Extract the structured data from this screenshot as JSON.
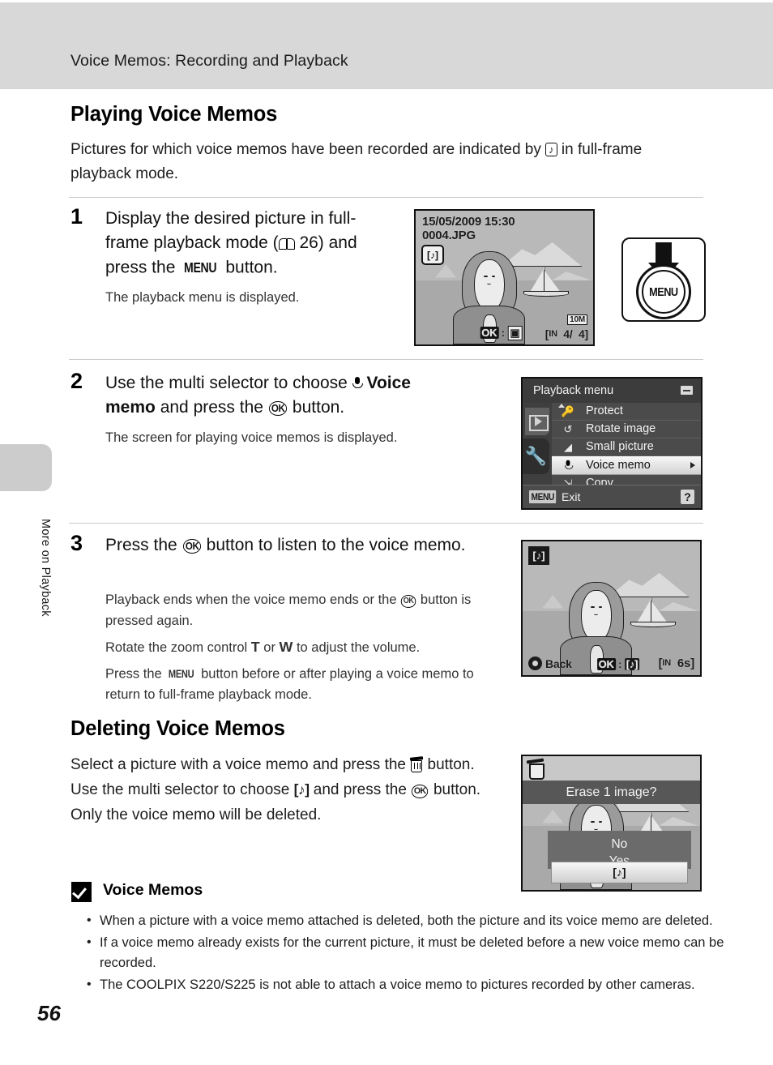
{
  "header": {
    "running_title": "Voice Memos: Recording and Playback"
  },
  "side": {
    "chapter_label": "More on Playback",
    "page_number": "56"
  },
  "sections": {
    "playing": {
      "heading": "Playing Voice Memos",
      "intro_before": "Pictures for which voice memos have been recorded are indicated by",
      "intro_icon": "voice-memo-icon",
      "intro_after": "in full-frame playback mode."
    },
    "deleting": {
      "heading": "Deleting Voice Memos",
      "text_1": "Select a picture with a voice memo and press the",
      "icon_1": "trash-icon",
      "text_2": "button. Use the multi selector to choose",
      "icon_2": "voice-memo-bracket-icon",
      "text_3": "and press",
      "text_4": "the",
      "icon_3": "ok-button-icon",
      "text_5": "button. Only the voice memo will be deleted."
    }
  },
  "steps": [
    {
      "number": "1",
      "title_1": "Display the desired picture in full-frame playback mode (",
      "title_ref": "26",
      "title_2": ") and press the",
      "title_menu": "MENU",
      "title_3": "button.",
      "sub": "The playback menu is displayed."
    },
    {
      "number": "2",
      "title_1": "Use the multi selector to choose",
      "title_bold_1": "Voice memo",
      "title_2": "and press the",
      "title_3": "button.",
      "sub": "The screen for playing voice memos is displayed."
    },
    {
      "number": "3",
      "title_1": "Press the",
      "title_2": "button to listen to the voice memo.",
      "sub_1a": "Playback ends when the voice memo ends or the",
      "sub_1b": "button is pressed again.",
      "sub_2a": "Rotate the zoom control",
      "sub_2_t": "T",
      "sub_2_or": "or",
      "sub_2_w": "W",
      "sub_2b": "to adjust the volume.",
      "sub_3a": "Press the",
      "sub_3_menu": "MENU",
      "sub_3b": "button before or after playing a voice memo to return to full-frame playback mode."
    }
  ],
  "lcd_playback": {
    "datetime": "15/05/2009 15:30",
    "filename": "0004.JPG",
    "memo_badge": "voice-memo-icon",
    "ok_label": "OK",
    "separator": ":",
    "mode_icon": "crop-playback-icon",
    "memory_icon": "IN",
    "frame_current": "4/",
    "frame_total": "4]",
    "image_size": "10M"
  },
  "menu_screen": {
    "title": "Playback menu",
    "battery_icon": "battery-icon",
    "tab_playback_icon": "playback-tab-icon",
    "tab_setup_icon": "wrench-tab-icon",
    "items": [
      {
        "label": "Protect",
        "icon": "key-icon",
        "selected": false
      },
      {
        "label": "Rotate image",
        "icon": "rotate-icon",
        "selected": false
      },
      {
        "label": "Small picture",
        "icon": "small-picture-icon",
        "selected": false
      },
      {
        "label": "Voice memo",
        "icon": "microphone-icon",
        "selected": true
      },
      {
        "label": "Copy",
        "icon": "copy-icon",
        "selected": false
      }
    ],
    "bottom_button": "MENU",
    "bottom_label": "Exit",
    "help_label": "?"
  },
  "lcd_memo_play": {
    "memo_badge": "voice-memo-icon",
    "back_label": "Back",
    "ok_label": "OK",
    "separator": ":",
    "play_icon": "voice-memo-bracket-icon",
    "memory_icon": "IN",
    "duration": "6s"
  },
  "lcd_erase": {
    "trash_icon": "trash-icon",
    "title": "Erase 1 image?",
    "option_no": "No",
    "option_yes": "Yes",
    "option_memo": "voice-memo-bracket-icon"
  },
  "menu_button_art": {
    "arrow_icon": "down-arrow-icon",
    "button_label": "MENU"
  },
  "note": {
    "icon": "caution-check-icon",
    "heading": "Voice Memos",
    "bullets": [
      "When a picture with a voice memo attached is deleted, both the picture and its voice memo are deleted.",
      "If a voice memo already exists for the current picture, it must be deleted before a new voice memo can be recorded.",
      "The COOLPIX S220/S225 is not able to attach a voice memo to pictures recorded by other cameras."
    ]
  },
  "colors": {
    "header_band": "#d8d8d8",
    "side_tab": "#cccccc",
    "rule": "#c9c9c9",
    "menu_bg": "#4b4b4b",
    "lcd_bg": "#b4b4b4"
  }
}
